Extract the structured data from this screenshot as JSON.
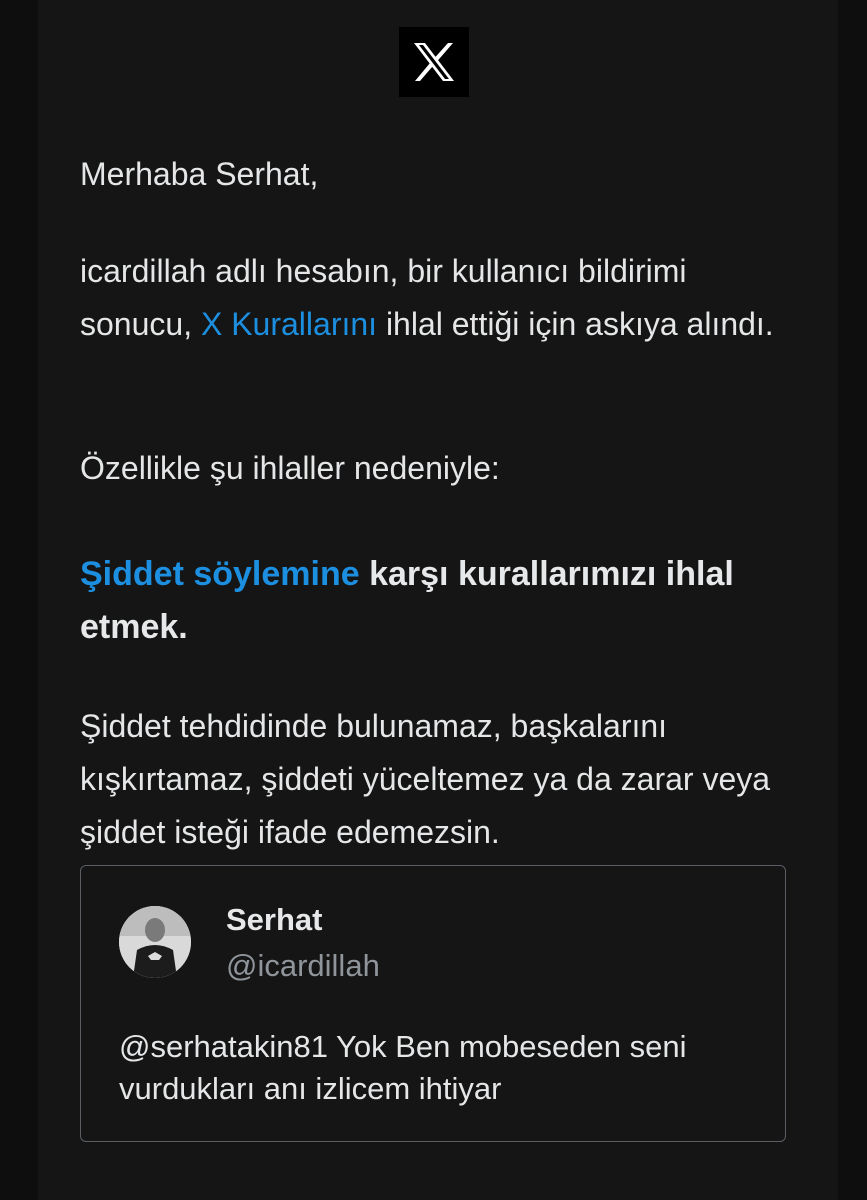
{
  "header": {
    "logo_icon": "x-logo-icon"
  },
  "email": {
    "greeting": "Merhaba Serhat,",
    "para1": {
      "before_link": "icardillah adlı hesabın, bir kullanıcı bildirimi sonucu, ",
      "link_text": "X Kurallarını",
      "after_link": " ihlal ettiği için askıya alındı."
    },
    "para2": "Özellikle şu ihlaller nedeniyle:",
    "violation": {
      "link_text": "Şiddet söylemine",
      "rest": " karşı kurallarımızı ihlal etmek."
    },
    "para3": "Şiddet tehdidinde bulunamaz, başkalarını kışkırtamaz, şiddeti yüceltemez ya da zarar veya şiddet isteği ifade edemezsin."
  },
  "tweet": {
    "avatar_icon": "user-avatar",
    "author_name": "Serhat",
    "author_handle": "@icardillah",
    "text": "@serhatakin81 Yok Ben mobeseden seni vurdukları anı izlicem ihtiyar"
  },
  "colors": {
    "background": "#0e0e0e",
    "panel": "#151515",
    "text": "#e4e6e8",
    "link": "#1d8fe0",
    "muted": "#8f959b",
    "card_border": "#5a5e63"
  }
}
